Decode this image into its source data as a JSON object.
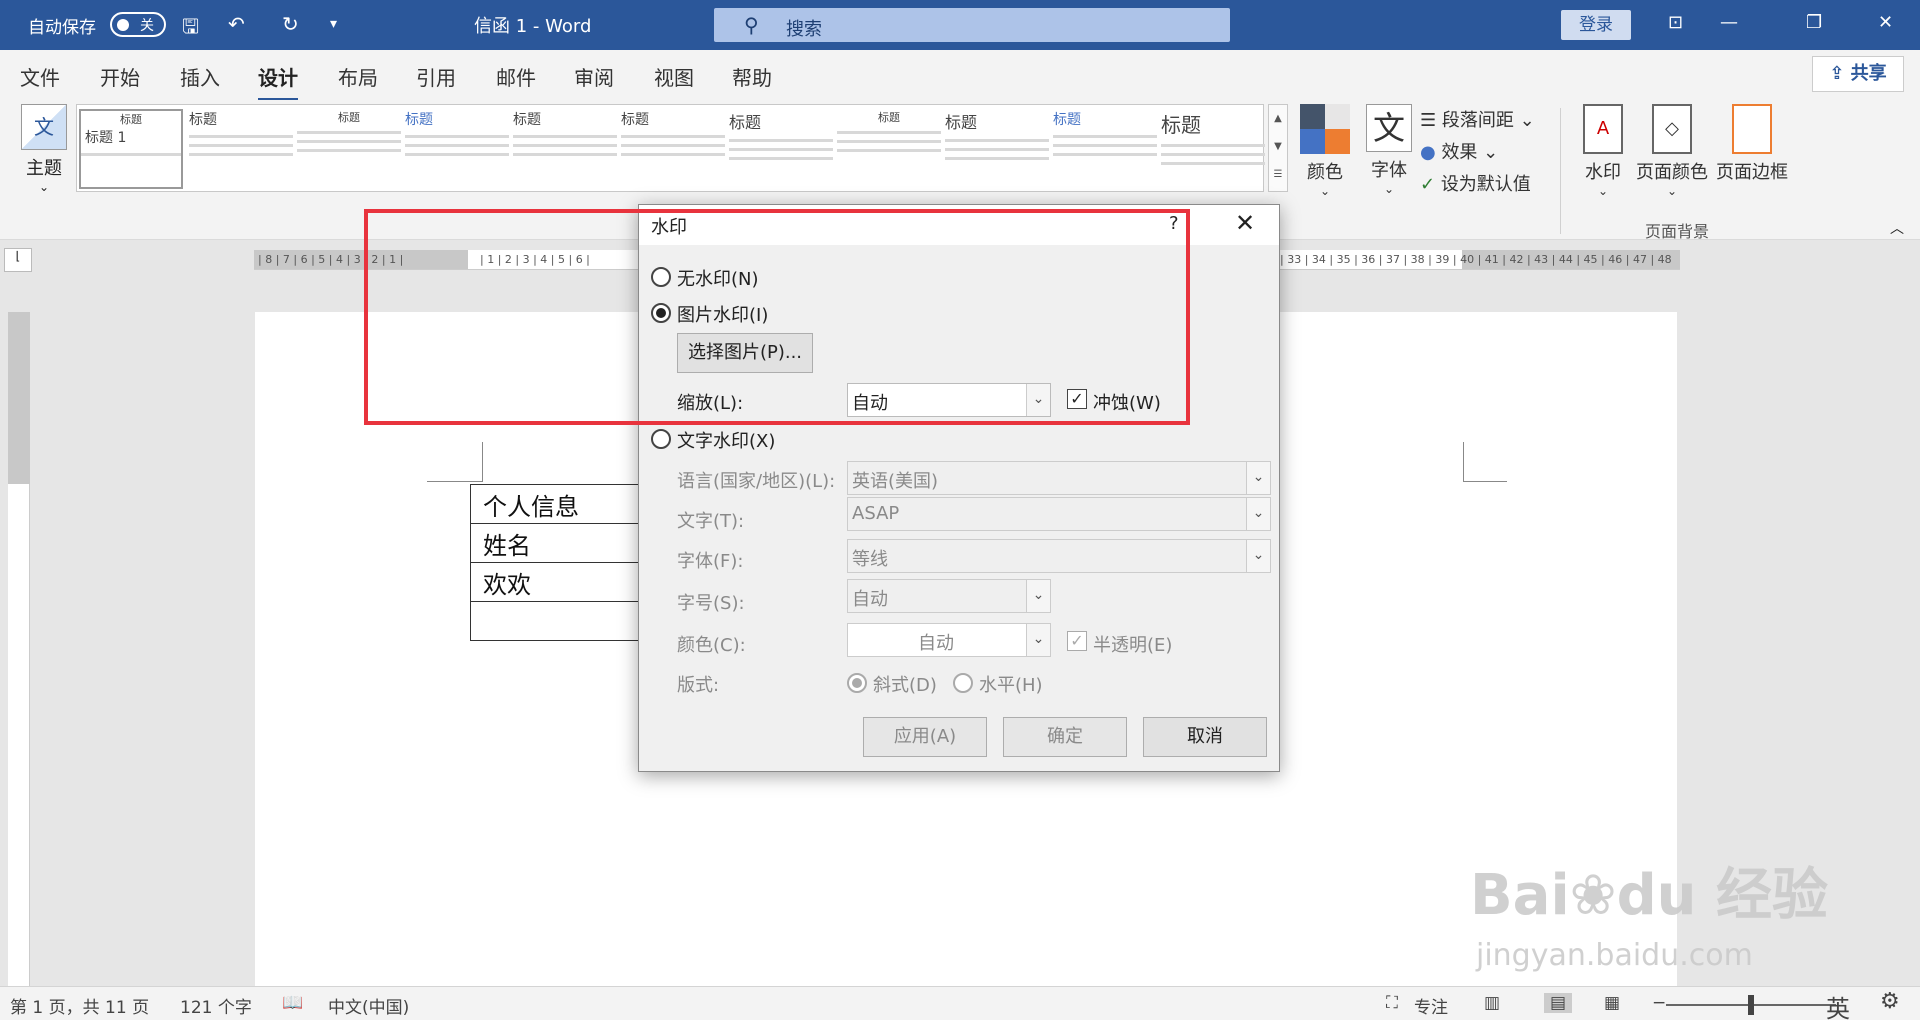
{
  "titlebar": {
    "autosave_label": "自动保存",
    "autosave_state": "关",
    "doc_title": "信函 1  -  Word",
    "search_placeholder": "搜索",
    "login_label": "登录"
  },
  "tabs": [
    "文件",
    "开始",
    "插入",
    "设计",
    "布局",
    "引用",
    "邮件",
    "审阅",
    "视图",
    "帮助"
  ],
  "active_tab": "设计",
  "share_label": "共享",
  "ribbon": {
    "theme_label": "主题",
    "gallery_titles": [
      "标题 1",
      "标题",
      "标题",
      "标题",
      "标题",
      "标题",
      "标题",
      "标题",
      "标题",
      "标题",
      "标题",
      "标题"
    ],
    "colors_label": "颜色",
    "fonts_label": "字体",
    "paragraph_spacing": "段落间距",
    "effects": "效果",
    "set_default": "设为默认值",
    "watermark_btn": "水印",
    "page_color_btn": "页面颜色",
    "page_border_btn": "页面边框",
    "page_bg_group": "页面背景"
  },
  "document": {
    "table_rows": [
      "个人信息",
      "姓名",
      "欢欢",
      ""
    ]
  },
  "dialog": {
    "title": "水印",
    "help": "?",
    "no_watermark": "无水印(N)",
    "picture_watermark": "图片水印(I)",
    "select_picture": "选择图片(P)...",
    "scale_label": "缩放(L):",
    "scale_value": "自动",
    "washout_label": "冲蚀(W)",
    "text_watermark": "文字水印(X)",
    "language_label": "语言(国家/地区)(L):",
    "language_value": "英语(美国)",
    "text_label": "文字(T):",
    "text_value": "ASAP",
    "font_label": "字体(F):",
    "font_value": "等线",
    "size_label": "字号(S):",
    "size_value": "自动",
    "color_label": "颜色(C):",
    "color_value": "自动",
    "semitransparent_label": "半透明(E)",
    "layout_label": "版式:",
    "diagonal_label": "斜式(D)",
    "horizontal_label": "水平(H)",
    "apply_btn": "应用(A)",
    "ok_btn": "确定",
    "cancel_btn": "取消",
    "selected_option": "picture"
  },
  "statusbar": {
    "page_info": "第 1 页，共 11 页",
    "word_count": "121 个字",
    "language": "中文(中国)",
    "focus": "专注",
    "ime": "英"
  },
  "colors": {
    "title_bar": "#2b579a",
    "highlight": "#e8333d"
  }
}
